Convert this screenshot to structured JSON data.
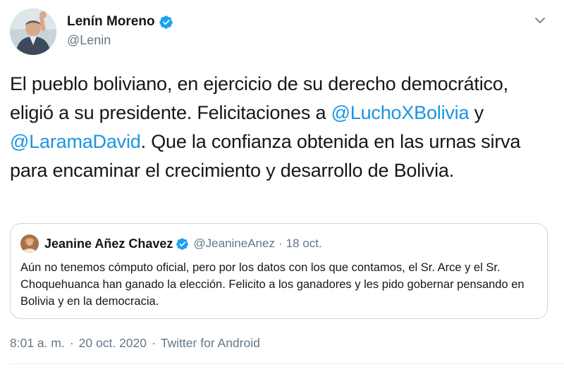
{
  "tweet": {
    "author": {
      "name": "Lenín Moreno",
      "handle": "@Lenin"
    },
    "body": {
      "part1": "El pueblo boliviano, en ejercicio de su derecho democrático, eligió a su presidente. Felicitaciones a ",
      "mention1": "@LuchoXBolivia",
      "part2": " y ",
      "mention2": "@LaramaDavid",
      "part3": ". Que la confianza obtenida en las urnas sirva para encaminar el crecimiento y desarrollo de Bolivia."
    },
    "quote": {
      "name": "Jeanine Añez Chavez",
      "handle": "@JeanineAnez",
      "separator": "·",
      "date": "18 oct.",
      "text": "Aún no tenemos cómputo oficial, pero por los datos con los que contamos, el Sr. Arce y el Sr. Choquehuanca han  ganado la elección. Felicito a los ganadores y les pido gobernar pensando en Bolivia y en la democracia."
    },
    "meta": {
      "time": "8:01 a. m.",
      "separator": "·",
      "date": "20 oct. 2020",
      "source": "Twitter for Android"
    }
  },
  "icons": {
    "verified": "verified-badge-icon",
    "caret": "chevron-down-icon"
  },
  "colors": {
    "link": "#1b95e0",
    "verified": "#1da1f2",
    "secondary_text": "#657786",
    "border": "#ccd6dd"
  }
}
